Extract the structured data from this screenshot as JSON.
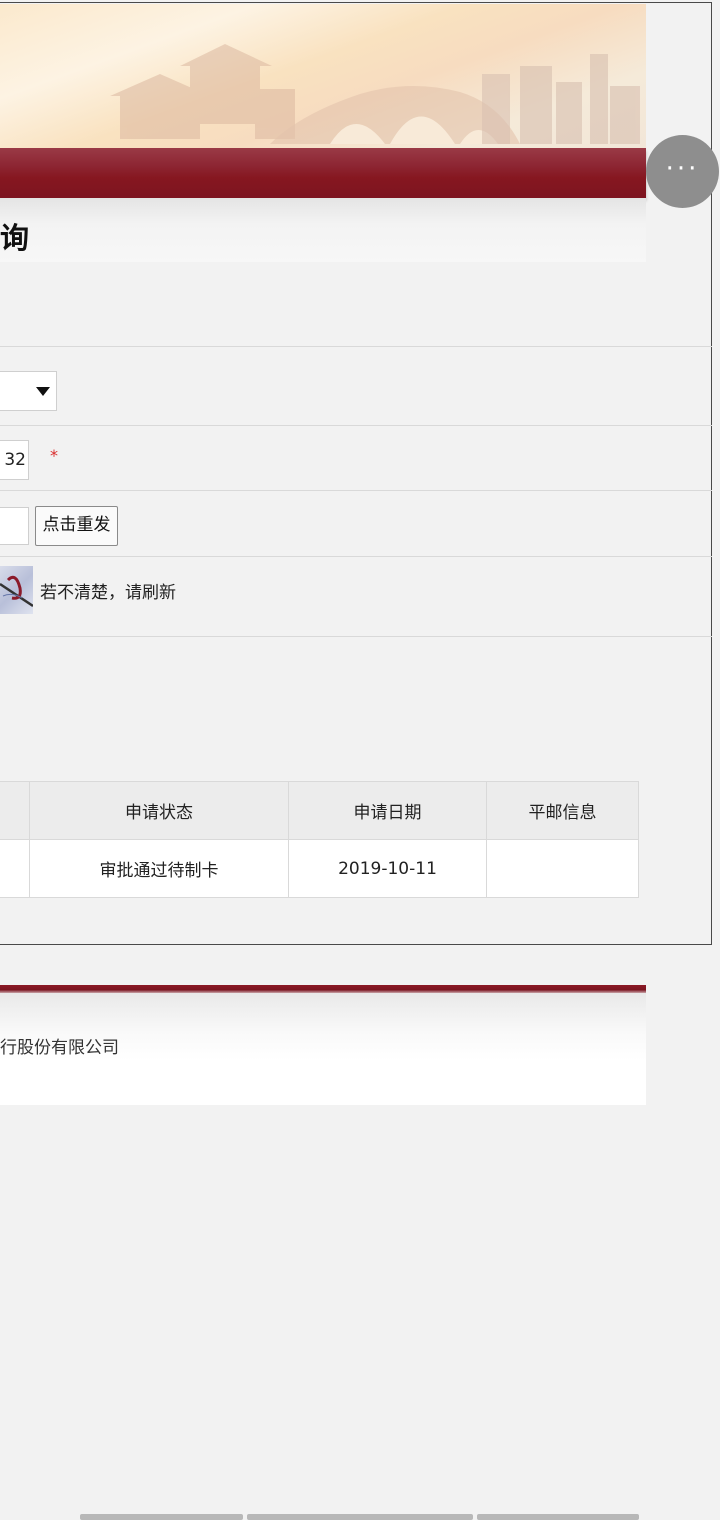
{
  "header": {
    "page_title": "询",
    "more_button_label": "···"
  },
  "form": {
    "id_number_value": "32",
    "required_mark": "*",
    "resend_button_label": "点击重发",
    "captcha_hint": "若不清楚，请刷新"
  },
  "table": {
    "headers": [
      "申请状态",
      "申请日期",
      "平邮信息"
    ],
    "rows": [
      [
        "审批通过待制卡",
        "2019-10-11",
        ""
      ]
    ]
  },
  "footer": {
    "text": "行股份有限公司"
  },
  "colors": {
    "accent_red": "#861720",
    "required": "#d92c2c"
  }
}
